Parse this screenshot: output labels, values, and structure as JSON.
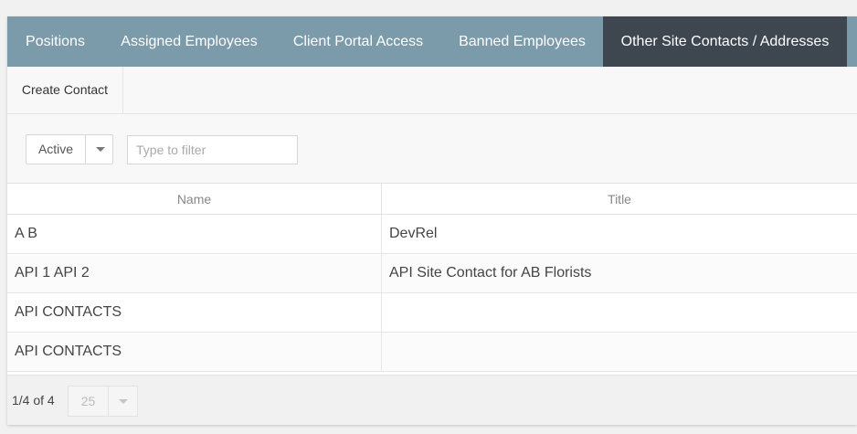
{
  "tabs": [
    {
      "label": "Positions",
      "active": false
    },
    {
      "label": "Assigned Employees",
      "active": false
    },
    {
      "label": "Client Portal Access",
      "active": false
    },
    {
      "label": "Banned Employees",
      "active": false
    },
    {
      "label": "Other Site Contacts / Addresses",
      "active": true
    }
  ],
  "toolbar": {
    "create_label": "Create Contact"
  },
  "filter": {
    "status_value": "Active",
    "status_icon": "chevron-down-icon",
    "search_placeholder": "Type to filter",
    "search_value": ""
  },
  "table": {
    "columns": [
      "Name",
      "Title"
    ],
    "rows": [
      {
        "name": "A B",
        "title": "DevRel"
      },
      {
        "name": "API 1 API 2",
        "title": "API Site Contact for AB Florists"
      },
      {
        "name": "API CONTACTS",
        "title": ""
      },
      {
        "name": "API CONTACTS",
        "title": ""
      }
    ]
  },
  "pagination": {
    "info": "1/4 of 4",
    "page_size": "25",
    "page_size_icon": "chevron-down-icon"
  },
  "colors": {
    "tab_bar": "#7b9bab",
    "tab_active": "#3e4650",
    "page_background": "#f1f1f1"
  }
}
